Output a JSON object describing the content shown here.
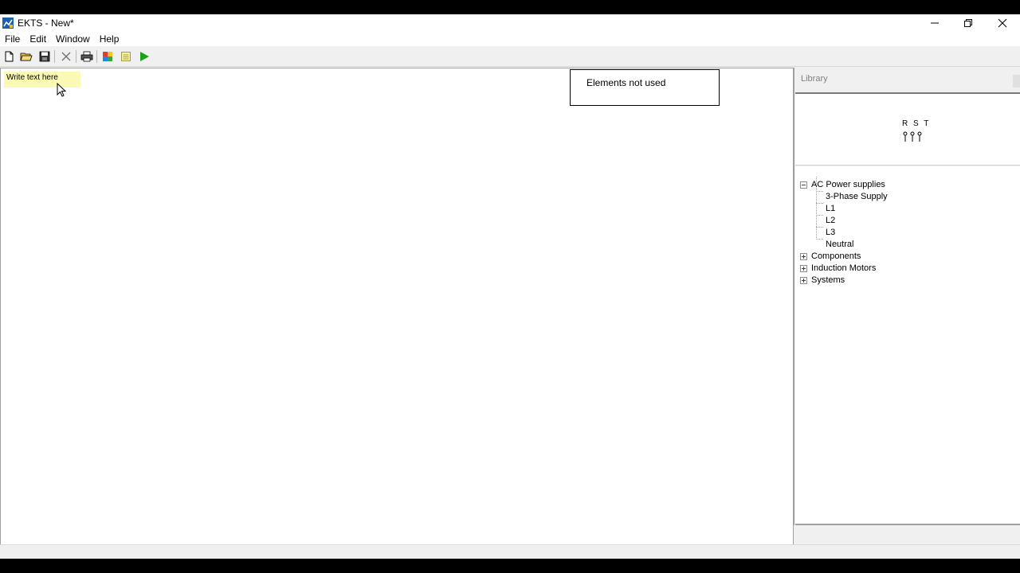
{
  "window": {
    "title": "EKTS - New*"
  },
  "menu": {
    "items": [
      "File",
      "Edit",
      "Window",
      "Help"
    ]
  },
  "toolbar": {
    "buttons": [
      "new-file-icon",
      "open-folder-icon",
      "save-icon",
      "delete-icon",
      "print-icon",
      "color-palette-icon",
      "notes-icon",
      "run-play-icon"
    ]
  },
  "canvas": {
    "note_text": "Write text here",
    "unused_box_label": "Elements not used"
  },
  "library": {
    "title": "Library",
    "preview_label": "R S T",
    "tree": {
      "group1": "AC Power supplies",
      "group1_children": [
        "3-Phase Supply",
        "L1",
        "L2",
        "L3",
        "Neutral"
      ],
      "group2": "Components",
      "group3": "Induction Motors",
      "group4": "Systems"
    }
  },
  "colors": {
    "note_bg": "#fafab4",
    "run_green": "#1aa31a"
  }
}
